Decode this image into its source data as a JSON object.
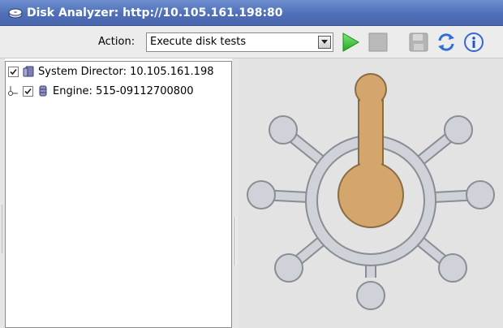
{
  "window": {
    "title_prefix": "Disk Analyzer: ",
    "title_url": "http://10.105.161.198:80",
    "title_icon": "disk-icon"
  },
  "toolbar": {
    "action_label": "Action:",
    "action_selected": "Execute disk tests",
    "buttons": [
      {
        "name": "play",
        "icon": "play-icon",
        "enabled": true
      },
      {
        "name": "stop",
        "icon": "stop-icon",
        "enabled": false
      },
      {
        "name": "save",
        "icon": "save-icon",
        "enabled": false
      },
      {
        "name": "refresh",
        "icon": "refresh-icon",
        "enabled": true
      },
      {
        "name": "info",
        "icon": "info-icon",
        "enabled": true
      }
    ]
  },
  "tree": {
    "items": [
      {
        "label": "System Director: 10.105.161.198",
        "checked": true,
        "icon": "server-icon"
      },
      {
        "label": "Engine: 515-09112700800",
        "checked": true,
        "icon": "database-icon"
      }
    ]
  },
  "colors": {
    "title_bar": "#5577c0",
    "play_green": "#3fc23f",
    "graphic_gold": "#d4a66d",
    "graphic_gray": "#cfd2d8",
    "preview_bg": "#e3e3e3"
  }
}
